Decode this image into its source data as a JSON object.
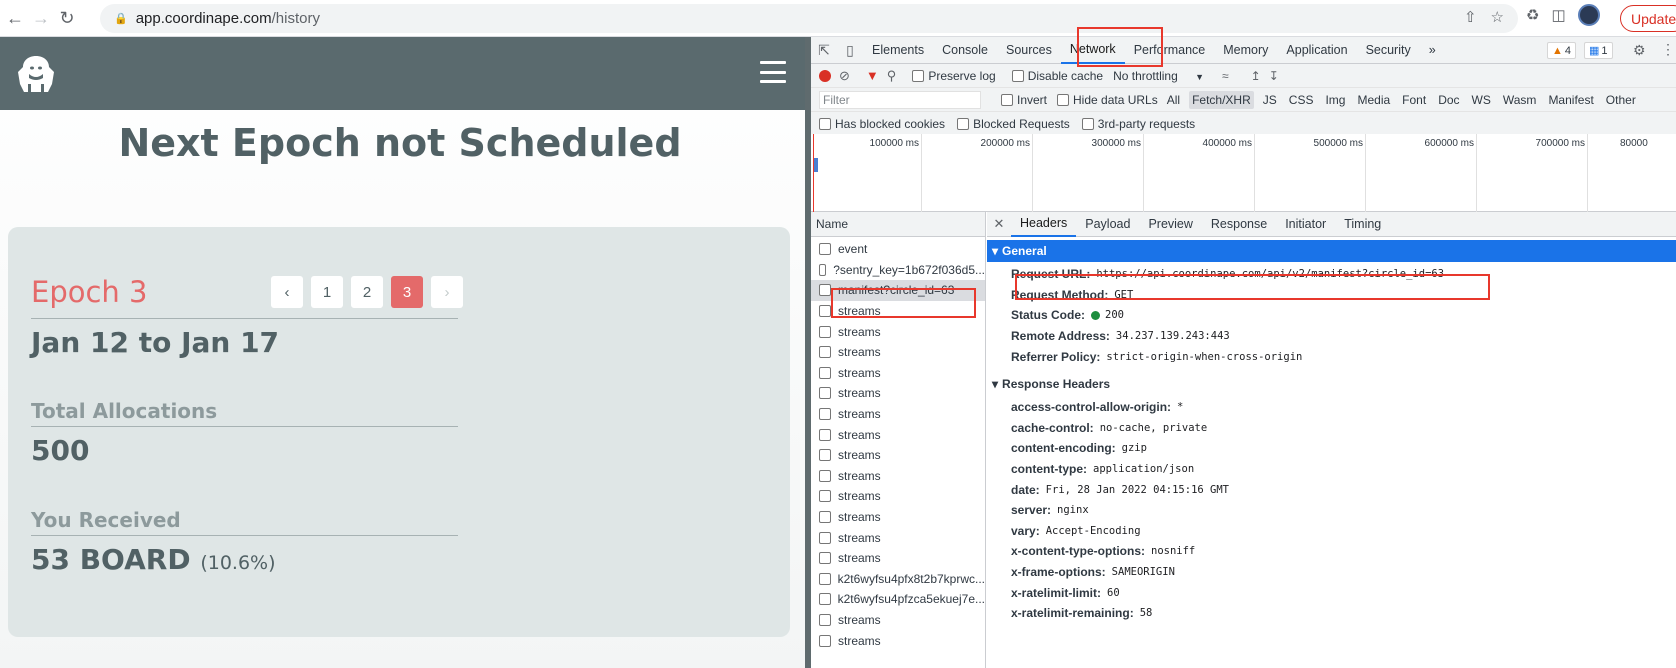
{
  "browser": {
    "url_host": "app.coordinape.com",
    "url_path": "/history",
    "update_label": "Update"
  },
  "app": {
    "heading": "Next Epoch not Scheduled",
    "epoch_title": "Epoch 3",
    "pager": [
      "1",
      "2",
      "3"
    ],
    "pager_active": "3",
    "date_range": "Jan 12 to Jan 17",
    "total_allocations_label": "Total Allocations",
    "total_allocations_value": "500",
    "you_received_label": "You Received",
    "you_received_value": "53 BOARD",
    "you_received_pct": "(10.6%)"
  },
  "devtools": {
    "tabs": [
      "Elements",
      "Console",
      "Sources",
      "Network",
      "Performance",
      "Memory",
      "Application",
      "Security"
    ],
    "active_tab": "Network",
    "warn_count": "4",
    "info_count": "1",
    "toolbar": {
      "preserve_log": "Preserve log",
      "disable_cache": "Disable cache",
      "throttling": "No throttling"
    },
    "filter_placeholder": "Filter",
    "filter_options": {
      "invert": "Invert",
      "hide_data_urls": "Hide data URLs"
    },
    "types": [
      "All",
      "Fetch/XHR",
      "JS",
      "CSS",
      "Img",
      "Media",
      "Font",
      "Doc",
      "WS",
      "Wasm",
      "Manifest",
      "Other"
    ],
    "active_type": "Fetch/XHR",
    "filter_row2": [
      "Has blocked cookies",
      "Blocked Requests",
      "3rd-party requests"
    ],
    "timeline_ticks": [
      "100000 ms",
      "200000 ms",
      "300000 ms",
      "400000 ms",
      "500000 ms",
      "600000 ms",
      "700000 ms",
      "80000"
    ],
    "name_header": "Name",
    "requests": [
      "event",
      "?sentry_key=1b672f036d5...",
      "manifest?circle_id=63",
      "streams",
      "streams",
      "streams",
      "streams",
      "streams",
      "streams",
      "streams",
      "streams",
      "streams",
      "streams",
      "streams",
      "streams",
      "streams",
      "k2t6wyfsu4pfx8t2b7kprwc...",
      "k2t6wyfsu4pfzca5ekuej7e...",
      "streams",
      "streams"
    ],
    "selected_request": "manifest?circle_id=63",
    "detail_tabs": [
      "Headers",
      "Payload",
      "Preview",
      "Response",
      "Initiator",
      "Timing"
    ],
    "active_detail_tab": "Headers",
    "general_label": "General",
    "general": [
      {
        "k": "Request URL:",
        "v": "https://api.coordinape.com/api/v2/manifest?circle_id=63"
      },
      {
        "k": "Request Method:",
        "v": "GET"
      },
      {
        "k": "Status Code:",
        "v": "200"
      },
      {
        "k": "Remote Address:",
        "v": "34.237.139.243:443"
      },
      {
        "k": "Referrer Policy:",
        "v": "strict-origin-when-cross-origin"
      }
    ],
    "response_headers_label": "Response Headers",
    "response_headers": [
      {
        "k": "access-control-allow-origin:",
        "v": "*"
      },
      {
        "k": "cache-control:",
        "v": "no-cache, private"
      },
      {
        "k": "content-encoding:",
        "v": "gzip"
      },
      {
        "k": "content-type:",
        "v": "application/json"
      },
      {
        "k": "date:",
        "v": "Fri, 28 Jan 2022 04:15:16 GMT"
      },
      {
        "k": "server:",
        "v": "nginx"
      },
      {
        "k": "vary:",
        "v": "Accept-Encoding"
      },
      {
        "k": "x-content-type-options:",
        "v": "nosniff"
      },
      {
        "k": "x-frame-options:",
        "v": "SAMEORIGIN"
      },
      {
        "k": "x-ratelimit-limit:",
        "v": "60"
      },
      {
        "k": "x-ratelimit-remaining:",
        "v": "58"
      }
    ],
    "status_color": "#1e8e3e",
    "highlight_color": "#e8382c"
  }
}
